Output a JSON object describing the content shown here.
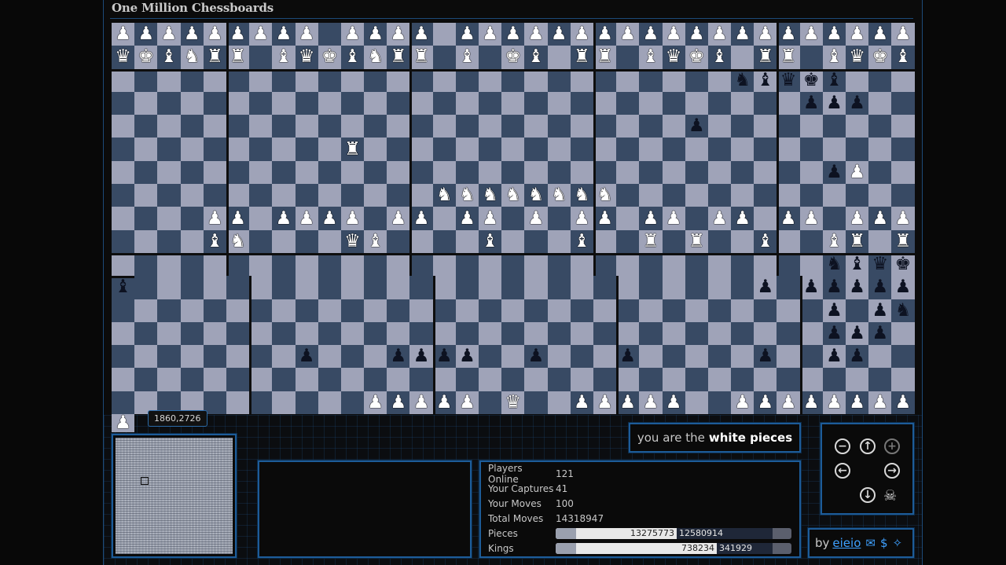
{
  "title": "One Million Chessboards",
  "coordinates": "1860,2726",
  "you_are": {
    "prefix": "you are the",
    "side": "white pieces"
  },
  "stats": {
    "players_online_label": "Players Online",
    "players_online": "121",
    "captures_label": "Your Captures",
    "captures": "41",
    "moves_label": "Your Moves",
    "moves": "100",
    "total_moves_label": "Total Moves",
    "total_moves": "14318947",
    "pieces_label": "Pieces",
    "pieces_white": "13275773",
    "pieces_black": "12580914",
    "pieces_white_fraction": 0.5135,
    "pieces_black_fraction": 0.4865,
    "kings_label": "Kings",
    "kings_white": "738234",
    "kings_black": "341929",
    "kings_white_fraction": 0.6834,
    "kings_black_fraction": 0.3166
  },
  "credits": {
    "by": "by",
    "author": "eieio",
    "icons": [
      "mail-icon",
      "dollar-icon",
      "twitter-icon"
    ]
  },
  "nav": {
    "buttons": [
      "zoom-out",
      "up",
      "zoom-in",
      "left",
      "right",
      "down",
      "skull"
    ]
  },
  "colors": {
    "accent": "#1d5c99",
    "light_square": "#9fa3b8",
    "dark_square": "#384a64",
    "link": "#3ea0ff"
  },
  "board": {
    "rows": [
      "PPPPPPPPP.PPPP.PPPPPPPPPPPPPPPPPPPP",
      "QKBNRR.BQKBNRR.B.KB.RR.BQKB.RR.BQKB",
      "...........................nbqkb...",
      "..............................ppp..",
      ".........................p.........",
      "..........R........................",
      "...............................pP..",
      "..............NNNNNNNN.............",
      "....PP.PPPP.PP.PP.P.PP.PP.PP.PP.PPP",
      "....BN....QB....B...B..R.R..B..BR.R",
      "...............................nbqkb",
      "...........................p.ppppp.",
      "..............................p.pn.",
      "..............................ppp..",
      ".......p...pppp..p...p.....p..pp...",
      "...................................",
      "..........PPPPP.Q..PPPPP..PPPPPPPPP"
    ],
    "white_owned": "uppercase",
    "notes": "uppercase = white, lowercase = black"
  }
}
